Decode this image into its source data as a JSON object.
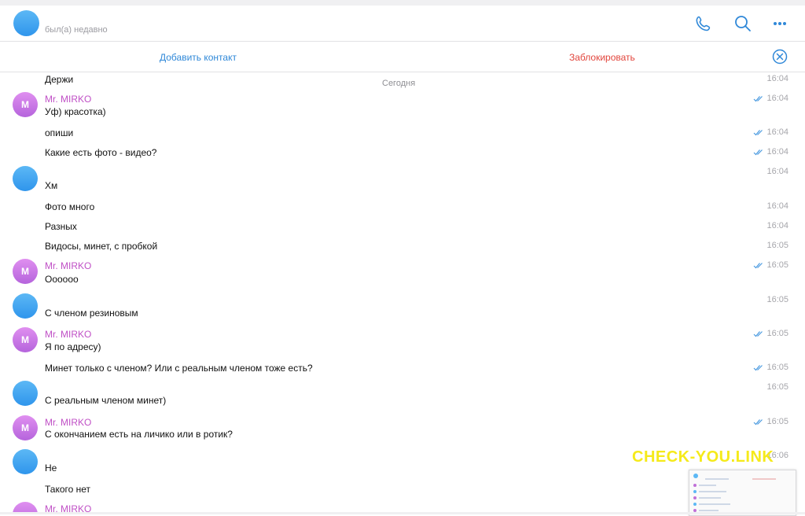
{
  "header": {
    "status": "был(а) недавно",
    "icons": [
      "phone-icon",
      "search-icon",
      "more-icon"
    ]
  },
  "actionbar": {
    "add_contact": "Добавить контакт",
    "block": "Заблокировать"
  },
  "chat": {
    "date_separator": "Сегодня",
    "sender_name": "Mr. MIRKO",
    "sender_avatar_letter": "M",
    "messages": [
      {
        "text": "Держи",
        "time": "16:04"
      },
      {
        "text": "Уф) красотка)",
        "time": "16:04"
      },
      {
        "text": "опиши",
        "time": "16:04"
      },
      {
        "text": "Какие есть фото - видео?",
        "time": "16:04"
      },
      {
        "text": "",
        "time": "16:04"
      },
      {
        "text": "Хм",
        "time": ""
      },
      {
        "text": "Фото много",
        "time": "16:04"
      },
      {
        "text": "Разных",
        "time": "16:04"
      },
      {
        "text": "Видосы, минет, с пробкой",
        "time": "16:05"
      },
      {
        "text": "Оооооо",
        "time": "16:05"
      },
      {
        "text": "С членом резиновым",
        "time": "16:05"
      },
      {
        "text": "Я по адресу)",
        "time": "16:05"
      },
      {
        "text": "Минет только с членом? Или с реальным членом тоже есть?",
        "time": "16:05"
      },
      {
        "text": "С реальным членом минет)",
        "time": "16:05"
      },
      {
        "text": "С окончанием есть на личико или в ротик?",
        "time": "16:05"
      },
      {
        "text": "Не",
        "time": "16:06"
      },
      {
        "text": "Такого нет",
        "time": ""
      }
    ]
  },
  "watermark": "CHECK-YOU.LINK",
  "colors": {
    "accent": "#2f88d8",
    "danger": "#e2463d",
    "sender": "#c050c6",
    "watermark": "#f5ea1a"
  }
}
